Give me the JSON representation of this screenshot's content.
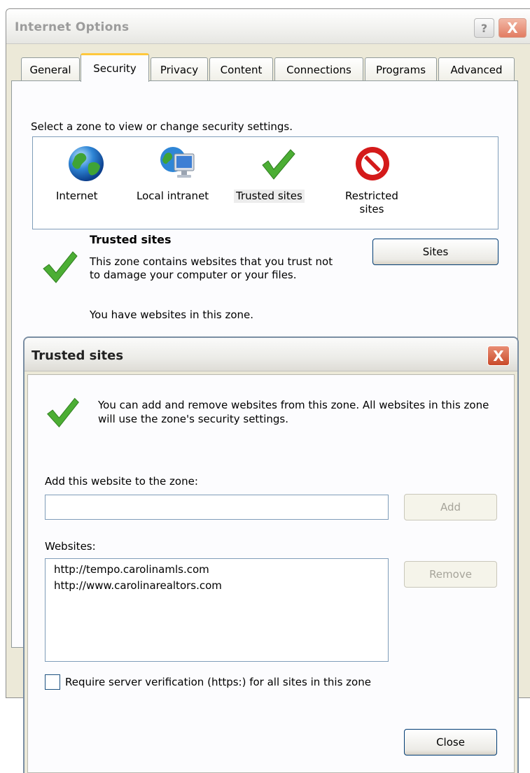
{
  "window": {
    "title": "Internet Options",
    "help_glyph": "?",
    "close_glyph": "X"
  },
  "tabs": [
    {
      "label": "General"
    },
    {
      "label": "Security"
    },
    {
      "label": "Privacy"
    },
    {
      "label": "Content"
    },
    {
      "label": "Connections"
    },
    {
      "label": "Programs"
    },
    {
      "label": "Advanced"
    }
  ],
  "active_tab": "Security",
  "security": {
    "prompt": "Select a zone to view or change security settings.",
    "zones": [
      {
        "label": "Internet",
        "icon": "globe-icon"
      },
      {
        "label": "Local intranet",
        "icon": "intranet-icon"
      },
      {
        "label": "Trusted sites",
        "icon": "checkmark-icon",
        "selected": true
      },
      {
        "label": "Restricted sites",
        "label_line1": "Restricted",
        "label_line2": "sites",
        "icon": "no-entry-icon"
      }
    ],
    "zone_title": "Trusted sites",
    "zone_description": "This zone contains websites that you trust not to damage your computer or your files.",
    "zone_status": "You have websites in this zone.",
    "sites_button": "Sites"
  },
  "dialog": {
    "title": "Trusted sites",
    "close_glyph": "X",
    "info_text": "You can add and remove websites from this zone. All websites in this zone will use the zone's security settings.",
    "add_label": "Add this website to the zone:",
    "add_input_value": "",
    "add_button": "Add",
    "websites_label": "Websites:",
    "websites": [
      "http://tempo.carolinamls.com",
      "http://www.carolinarealtors.com"
    ],
    "remove_button": "Remove",
    "require_https_label": "Require server verification (https:) for all sites in this zone",
    "require_https_checked": false,
    "close_button": "Close"
  },
  "colors": {
    "dialog_face": "#ece9d8",
    "check_green": "#4cae34",
    "tab_highlight": "#ffc83c",
    "restricted_red": "#d41a1a"
  }
}
